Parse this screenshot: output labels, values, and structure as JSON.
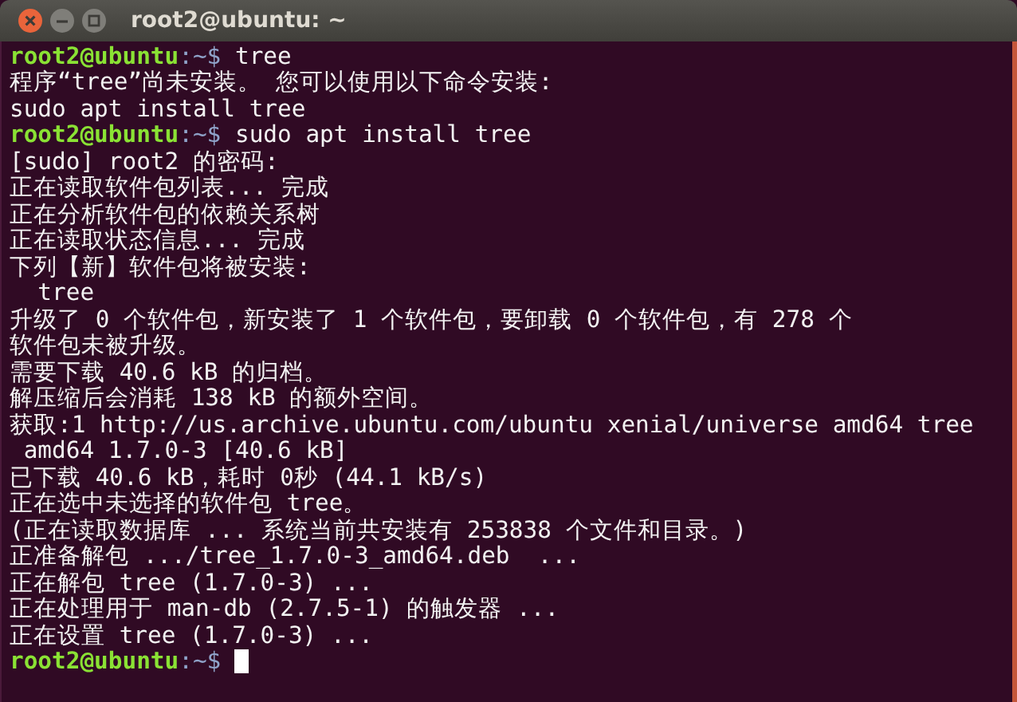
{
  "window": {
    "title": "root2@ubuntu: ~"
  },
  "lines": [
    {
      "kind": "prompt",
      "user_host": "root2@ubuntu",
      "path": ":~$",
      "command": " tree"
    },
    {
      "kind": "output",
      "text": "程序“tree”尚未安装。 您可以使用以下命令安装:"
    },
    {
      "kind": "output",
      "text": "sudo apt install tree"
    },
    {
      "kind": "prompt",
      "user_host": "root2@ubuntu",
      "path": ":~$",
      "command": " sudo apt install tree"
    },
    {
      "kind": "output",
      "text": "[sudo] root2 的密码:"
    },
    {
      "kind": "output",
      "text": "正在读取软件包列表... 完成"
    },
    {
      "kind": "output",
      "text": "正在分析软件包的依赖关系树"
    },
    {
      "kind": "output",
      "text": "正在读取状态信息... 完成"
    },
    {
      "kind": "output",
      "text": "下列【新】软件包将被安装:"
    },
    {
      "kind": "output",
      "text": "  tree"
    },
    {
      "kind": "output",
      "text": "升级了 0 个软件包，新安装了 1 个软件包，要卸载 0 个软件包，有 278 个"
    },
    {
      "kind": "output",
      "text": "软件包未被升级。"
    },
    {
      "kind": "output",
      "text": "需要下载 40.6 kB 的归档。"
    },
    {
      "kind": "output",
      "text": "解压缩后会消耗 138 kB 的额外空间。"
    },
    {
      "kind": "output",
      "text": "获取:1 http://us.archive.ubuntu.com/ubuntu xenial/universe amd64 tree"
    },
    {
      "kind": "output",
      "text": " amd64 1.7.0-3 [40.6 kB]"
    },
    {
      "kind": "output",
      "text": "已下载 40.6 kB，耗时 0秒 (44.1 kB/s)"
    },
    {
      "kind": "output",
      "text": "正在选中未选择的软件包 tree。"
    },
    {
      "kind": "output",
      "text": "(正在读取数据库 ... 系统当前共安装有 253838 个文件和目录。)"
    },
    {
      "kind": "output",
      "text": "正准备解包 .../tree_1.7.0-3_amd64.deb  ..."
    },
    {
      "kind": "output",
      "text": "正在解包 tree (1.7.0-3) ..."
    },
    {
      "kind": "output",
      "text": "正在处理用于 man-db (2.7.5-1) 的触发器 ..."
    },
    {
      "kind": "output",
      "text": "正在设置 tree (1.7.0-3) ..."
    },
    {
      "kind": "prompt",
      "user_host": "root2@ubuntu",
      "path": ":~$",
      "cursor": true
    }
  ]
}
